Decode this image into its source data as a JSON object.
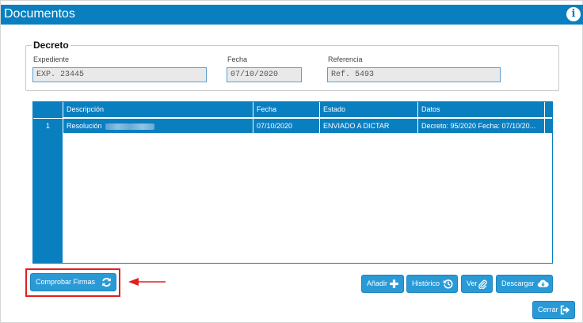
{
  "window": {
    "title": "Documentos",
    "info_icon": "info-icon"
  },
  "decreto": {
    "legend": "Decreto",
    "expediente": {
      "label": "Expediente",
      "value": "EXP. 23445"
    },
    "fecha": {
      "label": "Fecha",
      "value": "07/10/2020"
    },
    "referencia": {
      "label": "Referencia",
      "value": "Ref. 5493"
    }
  },
  "grid": {
    "columns": [
      "Descripción",
      "Fecha",
      "Estado",
      "Datos"
    ],
    "rows": [
      {
        "num": "1",
        "descripcion": "Resolución",
        "fecha": "07/10/2020",
        "estado": "ENVIADO A DICTAR",
        "datos": "Decreto: 95/2020 Fecha: 07/10/20..."
      }
    ]
  },
  "buttons": {
    "comprobar_firmas": "Comprobar Firmas",
    "anadir": "Añadir",
    "historico": "Histórico",
    "ver": "Ver",
    "descargar": "Descargar",
    "cerrar": "Cerrar"
  },
  "colors": {
    "primary": "#0a7fc0",
    "button": "#2a9ad6",
    "highlight": "#e02020"
  }
}
